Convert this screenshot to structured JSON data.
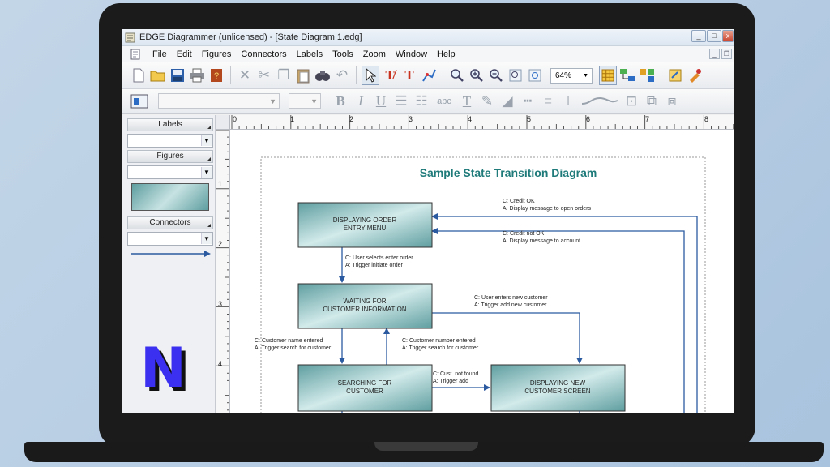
{
  "window": {
    "title": "EDGE Diagrammer (unlicensed) - [State Diagram 1.edg]",
    "buttons": [
      "_",
      "□",
      "x"
    ]
  },
  "menu": [
    "File",
    "Edit",
    "Figures",
    "Connectors",
    "Labels",
    "Tools",
    "Zoom",
    "Window",
    "Help"
  ],
  "toolbar": {
    "zoom": "64%"
  },
  "toolbar2": {
    "text_label": "abc"
  },
  "sidebar": {
    "labels_header": "Labels",
    "figures_header": "Figures",
    "connectors_header": "Connectors"
  },
  "ruler": {
    "h": [
      "0",
      "1",
      "2",
      "3",
      "4",
      "5",
      "6",
      "7",
      "8"
    ],
    "v": [
      "1",
      "2",
      "3",
      "4"
    ]
  },
  "diagram": {
    "title": "Sample State Transition Diagram",
    "states": [
      {
        "line1": "DISPLAYING ORDER",
        "line2": "ENTRY MENU"
      },
      {
        "line1": "WAITING FOR",
        "line2": "CUSTOMER INFORMATION"
      },
      {
        "line1": "SEARCHING FOR",
        "line2": "CUSTOMER"
      },
      {
        "line1": "DISPLAYING NEW",
        "line2": "CUSTOMER SCREEN"
      }
    ],
    "transitions": [
      {
        "c": "C: Credit OK",
        "a": "A: Display message to open orders"
      },
      {
        "c": "C: Credit not OK",
        "a": "A: Display message to account"
      },
      {
        "c": "C: User selects enter order",
        "a": "A: Trigger initiate order"
      },
      {
        "c": "C: User enters new customer",
        "a": "A: Trigger add new customer"
      },
      {
        "c": "C: Customer name entered",
        "a": "A: Trigger search for customer"
      },
      {
        "c": "C: Customer number entered",
        "a": "A: Trigger search for customer"
      },
      {
        "c": "C: Cust. not found",
        "a": "A: Trigger add"
      }
    ]
  },
  "overlay_logo": {
    "letter": "N",
    "color": "#3b2ff0"
  }
}
